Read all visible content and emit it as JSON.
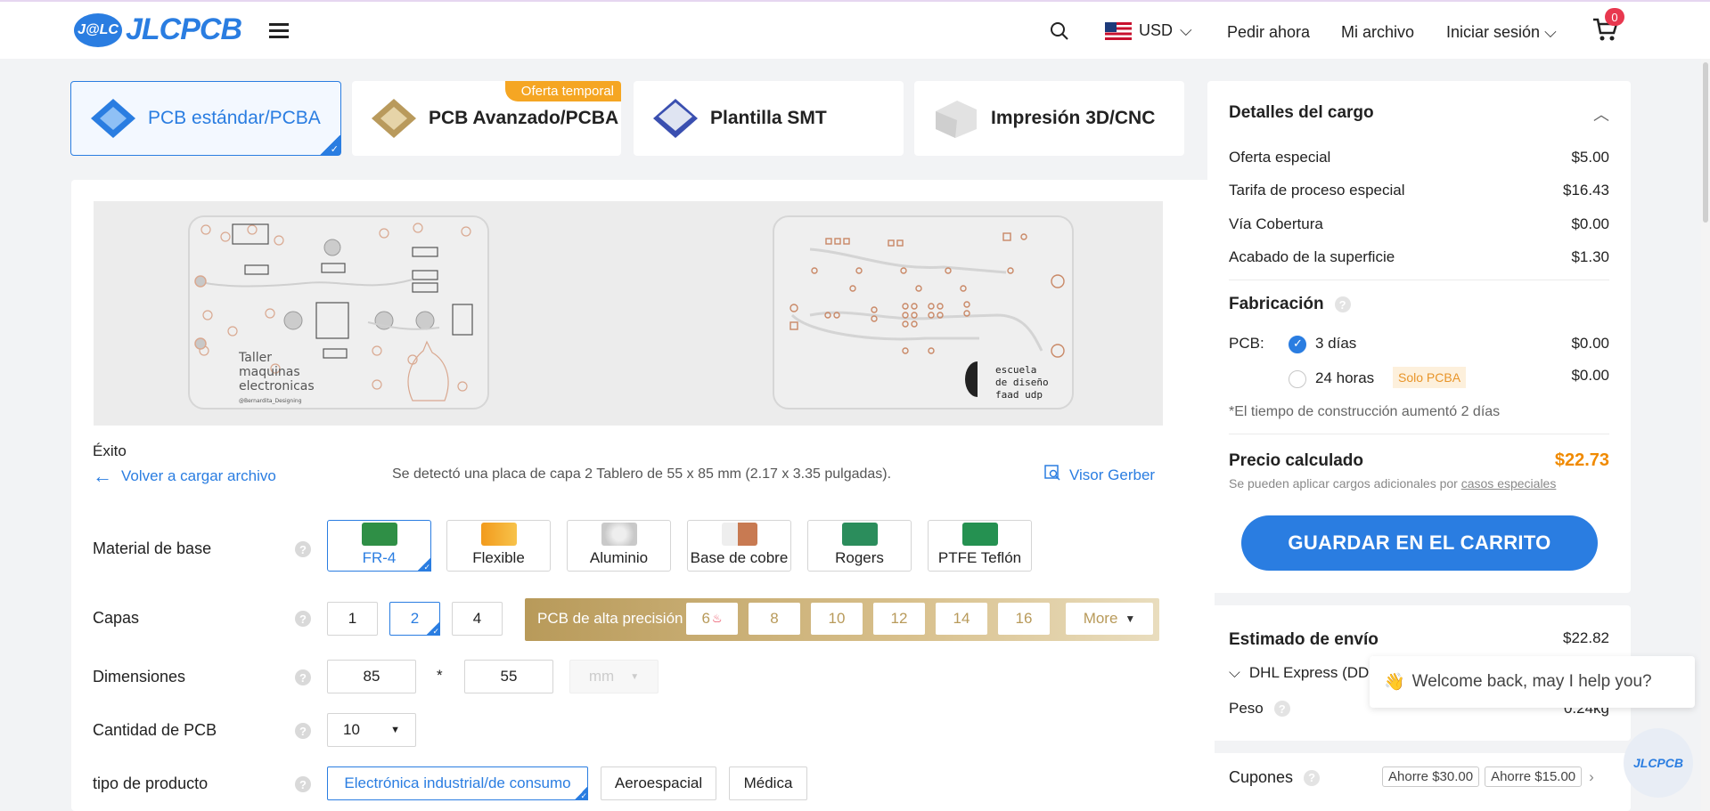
{
  "header": {
    "logo_badge": "J@LC",
    "logo_text": "JLCPCB",
    "currency": "USD",
    "links": [
      "Pedir ahora",
      "Mi archivo",
      "Iniciar sesión"
    ],
    "cart_count": "0"
  },
  "tabs": [
    {
      "label": "PCB estándar/PCBA",
      "active": true
    },
    {
      "label": "PCB Avanzado/PCBA",
      "promo": "Oferta temporal"
    },
    {
      "label": "Plantilla SMT"
    },
    {
      "label": "Impresión 3D/CNC"
    }
  ],
  "preview": {
    "silk_top": [
      "Taller",
      "maquinas",
      "electronicas",
      "@Bernardita_Designing"
    ],
    "silk_bottom": [
      "escuela",
      "de diseño",
      "faad udp"
    ]
  },
  "upload": {
    "status": "Éxito",
    "back_link": "Volver a cargar archivo",
    "detected": "Se detectó una placa de capa 2 Tablero de 55 x 85 mm (2.17 x 3.35 pulgadas).",
    "gerber": "Visor Gerber"
  },
  "form": {
    "material_label": "Material de base",
    "materials": [
      "FR-4",
      "Flexible",
      "Aluminio",
      "Base de cobre",
      "Rogers",
      "PTFE Teflón"
    ],
    "layers_label": "Capas",
    "layers": [
      "1",
      "2",
      "4"
    ],
    "high_precision_label": "PCB de alta precisión",
    "high_precision_layers": [
      "6",
      "8",
      "10",
      "12",
      "14",
      "16"
    ],
    "more": "More",
    "dimensions_label": "Dimensiones",
    "dim_x": "85",
    "dim_sep": "*",
    "dim_y": "55",
    "unit": "mm",
    "qty_label": "Cantidad de PCB",
    "qty": "10",
    "product_type_label": "tipo de producto",
    "product_types": [
      "Electrónica industrial/de consumo",
      "Aeroespacial",
      "Médica"
    ]
  },
  "charges": {
    "title": "Detalles del cargo",
    "items": [
      {
        "label": "Oferta especial",
        "value": "$5.00"
      },
      {
        "label": "Tarifa de proceso especial",
        "value": "$16.43"
      },
      {
        "label": "Vía Cobertura",
        "value": "$0.00"
      },
      {
        "label": "Acabado de la superficie",
        "value": "$1.30"
      }
    ],
    "fabrication_title": "Fabricación",
    "pcb_label": "PCB:",
    "options": [
      {
        "label": "3 días",
        "value": "$0.00",
        "selected": true
      },
      {
        "label": "24 horas",
        "value": "$0.00",
        "tag": "Solo PCBA"
      }
    ],
    "note": "*El tiempo de construcción aumentó 2 días",
    "estimated_label": "Precio calculado",
    "estimated_value": "$22.73",
    "extra_note": "Se pueden aplicar cargos adicionales por",
    "extra_link": "casos especiales",
    "cart_button": "GUARDAR EN EL CARRITO"
  },
  "shipping": {
    "title": "Estimado de envío",
    "value": "$22.82",
    "method": "DHL Express (DD",
    "weight_label": "Peso",
    "weight_value": "0.24kg"
  },
  "coupons": {
    "label": "Cupones",
    "items": [
      "Ahorre $30.00",
      "Ahorre $15.00"
    ]
  },
  "chat": {
    "message": "Welcome back, may I help you?",
    "fab": "JLCPCB"
  },
  "colors": {
    "accent": "#2a7de1",
    "price": "#f08a00",
    "promo": "#f5a623",
    "gold": "#b89a5a"
  }
}
